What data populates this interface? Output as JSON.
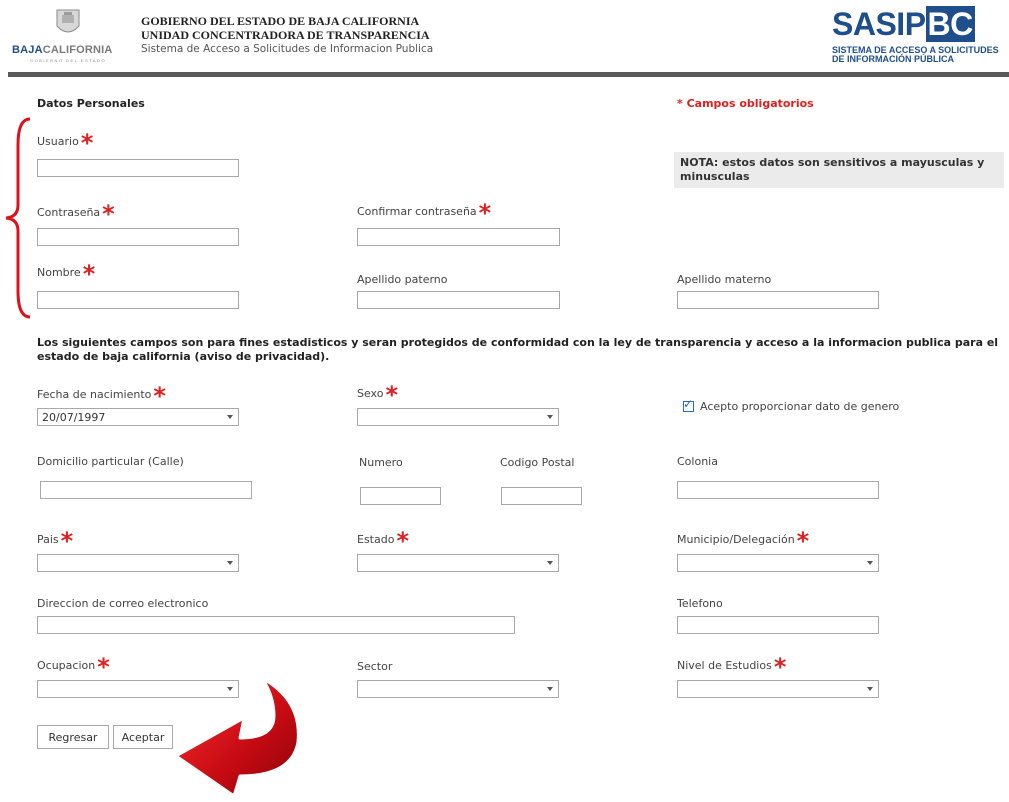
{
  "header": {
    "logo_name_part1": "BAJA",
    "logo_name_part2": "CALIFORNIA",
    "logo_sub": "GOBIERNO DEL ESTADO",
    "line1": "GOBIERNO DEL ESTADO DE BAJA CALIFORNIA",
    "line2": "UNIDAD CONCENTRADORA DE TRANSPARENCIA",
    "line3": "Sistema de Acceso a Solicitudes de Informacion Publica",
    "sasip_part1": "SASIP",
    "sasip_part2": "BC",
    "sasip_sub1": "SISTEMA DE ACCESO A SOLICITUDES",
    "sasip_sub2": "DE INFORMACIÓN PÚBLICA"
  },
  "section_title": "Datos Personales",
  "required_note": "* Campos obligatorios",
  "nota": "NOTA: estos datos son sensitivos a mayusculas y minusculas",
  "required_mark": "*",
  "labels": {
    "usuario": "Usuario",
    "contrasena": "Contraseña",
    "confirmar": "Confirmar contraseña",
    "nombre": "Nombre",
    "apellido_paterno": "Apellido paterno",
    "apellido_materno": "Apellido materno",
    "fecha_nacimiento": "Fecha de nacimiento",
    "sexo": "Sexo",
    "domicilio": "Domicilio particular (Calle)",
    "numero": "Numero",
    "codigo_postal": "Codigo Postal",
    "colonia": "Colonia",
    "pais": "Pais",
    "estado": "Estado",
    "municipio": "Municipio/Delegación",
    "correo": "Direccion de correo electronico",
    "telefono": "Telefono",
    "ocupacion": "Ocupacion",
    "sector": "Sector",
    "nivel_estudios": "Nivel de Estudios"
  },
  "stats_paragraph": "Los siguientes campos son para fines estadisticos y seran protegidos de conformidad con la ley de transparencia y acceso a la informacion publica para el estado de baja california (aviso de privacidad).",
  "values": {
    "fecha_nacimiento": "20/07/1997",
    "sexo": "",
    "pais": "",
    "estado": "",
    "municipio": "",
    "ocupacion": "",
    "sector": "",
    "nivel_estudios": ""
  },
  "checkbox_genero": {
    "label": "Acepto proporcionar dato de genero",
    "checked": true
  },
  "buttons": {
    "regresar": "Regresar",
    "aceptar": "Aceptar"
  },
  "colors": {
    "required": "#e02020",
    "brand_blue": "#1f4e8c",
    "annotation_red": "#d0101a"
  }
}
